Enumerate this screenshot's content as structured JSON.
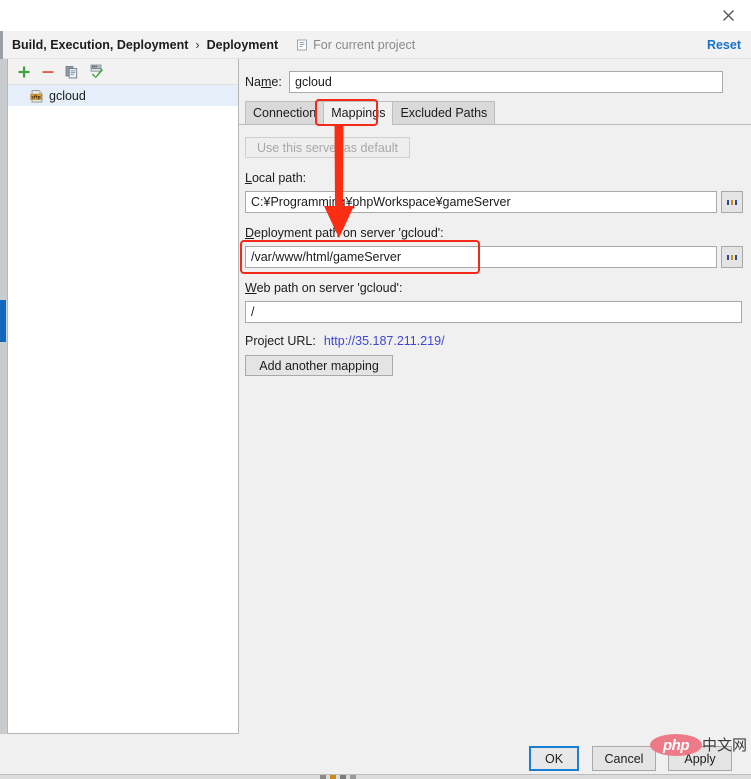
{
  "window": {
    "close_icon": "close-icon"
  },
  "breadcrumb": {
    "root": "Build, Execution, Deployment",
    "separator": "›",
    "current": "Deployment",
    "scope_icon": "project-scope-icon",
    "scope_label": "For current project",
    "reset_label": "Reset"
  },
  "tree": {
    "toolbar": [
      {
        "name": "add-button",
        "icon": "plus-icon",
        "color": "#3ba43b"
      },
      {
        "name": "remove-button",
        "icon": "minus-icon",
        "color": "#d4604d"
      },
      {
        "name": "copy-button",
        "icon": "copy-icon",
        "color": "#6e8fa8"
      },
      {
        "name": "set-default-button",
        "icon": "check-server-icon",
        "color": "#3ba43b"
      }
    ],
    "items": [
      {
        "icon": "sftp-server-icon",
        "label": "gcloud",
        "selected": true
      }
    ]
  },
  "detail": {
    "name_label_pre": "Na",
    "name_label_accel": "m",
    "name_label_post": "e:",
    "name_value": "gcloud",
    "name_placeholder": "Name",
    "tabs": [
      {
        "label": "Connection",
        "active": false
      },
      {
        "label": "Mappings",
        "active": true
      },
      {
        "label": "Excluded Paths",
        "active": false
      }
    ],
    "use_default_label": "Use this server as default",
    "local_path": {
      "label_accel": "L",
      "label_rest": "ocal path:",
      "value": "C:¥Programming¥phpWorkspace¥gameServer",
      "browse_label": "...",
      "browse_icon": "ellipsis-icon"
    },
    "deployment_path": {
      "label_accel": "D",
      "label_rest": "eployment path on server 'gcloud':",
      "value": "/var/www/html/gameServer",
      "browse_label": "...",
      "browse_icon": "ellipsis-icon"
    },
    "web_path": {
      "label_accel": "W",
      "label_rest": "eb path on server 'gcloud':",
      "value": "/"
    },
    "project_url_label": "Project URL:",
    "project_url_value": "http://35.187.211.219/",
    "add_mapping_label": "Add another mapping"
  },
  "annotations": {
    "highlight_color": "#f42a18",
    "arrow_name": "red-arrow-annotation",
    "tab_box_name": "mappings-tab-highlight",
    "deploy_box_name": "deployment-path-highlight"
  },
  "footer": {
    "ok_label": "OK",
    "cancel_label": "Cancel",
    "apply_label": "Apply"
  },
  "watermark": {
    "php_text": "php",
    "cn_text": "中文网"
  }
}
